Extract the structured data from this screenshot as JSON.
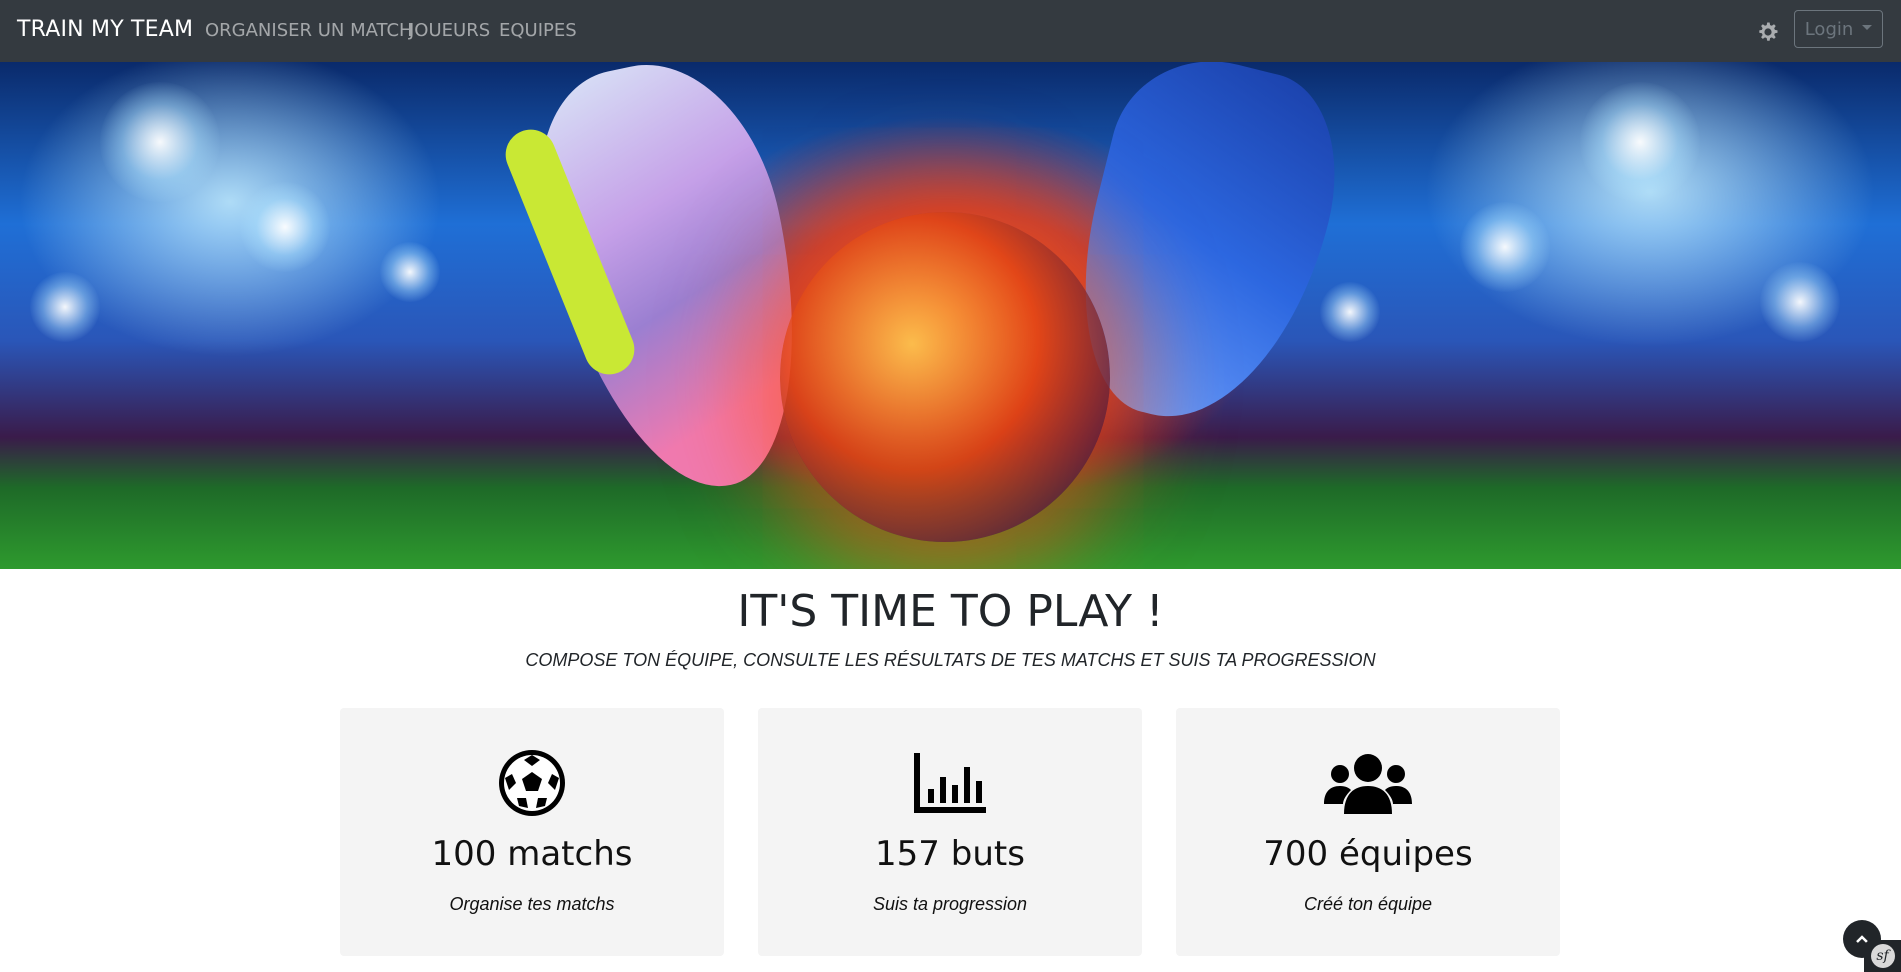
{
  "navbar": {
    "brand": "TRAIN MY TEAM",
    "links": [
      "ORGANISER UN MATCH",
      "JOUEURS",
      "EQUIPES"
    ],
    "settings_icon": "gear-icon",
    "login_label": "Login"
  },
  "hero": {
    "title": "IT'S TIME TO PLAY !",
    "subtitle": "COMPOSE TON ÉQUIPE, CONSULTE LES RÉSULTATS DE TES MATCHS ET SUIS TA PROGRESSION"
  },
  "stats": [
    {
      "icon": "soccer-ball-icon",
      "value": "100 matchs",
      "caption": "Organise tes matchs"
    },
    {
      "icon": "bar-chart-icon",
      "value": "157 buts",
      "caption": "Suis ta progression"
    },
    {
      "icon": "users-icon",
      "value": "700 équipes",
      "caption": "Créé ton équipe"
    }
  ],
  "colors": {
    "navbar_bg": "#343a40",
    "card_bg": "#f4f4f4",
    "text": "#212529"
  }
}
